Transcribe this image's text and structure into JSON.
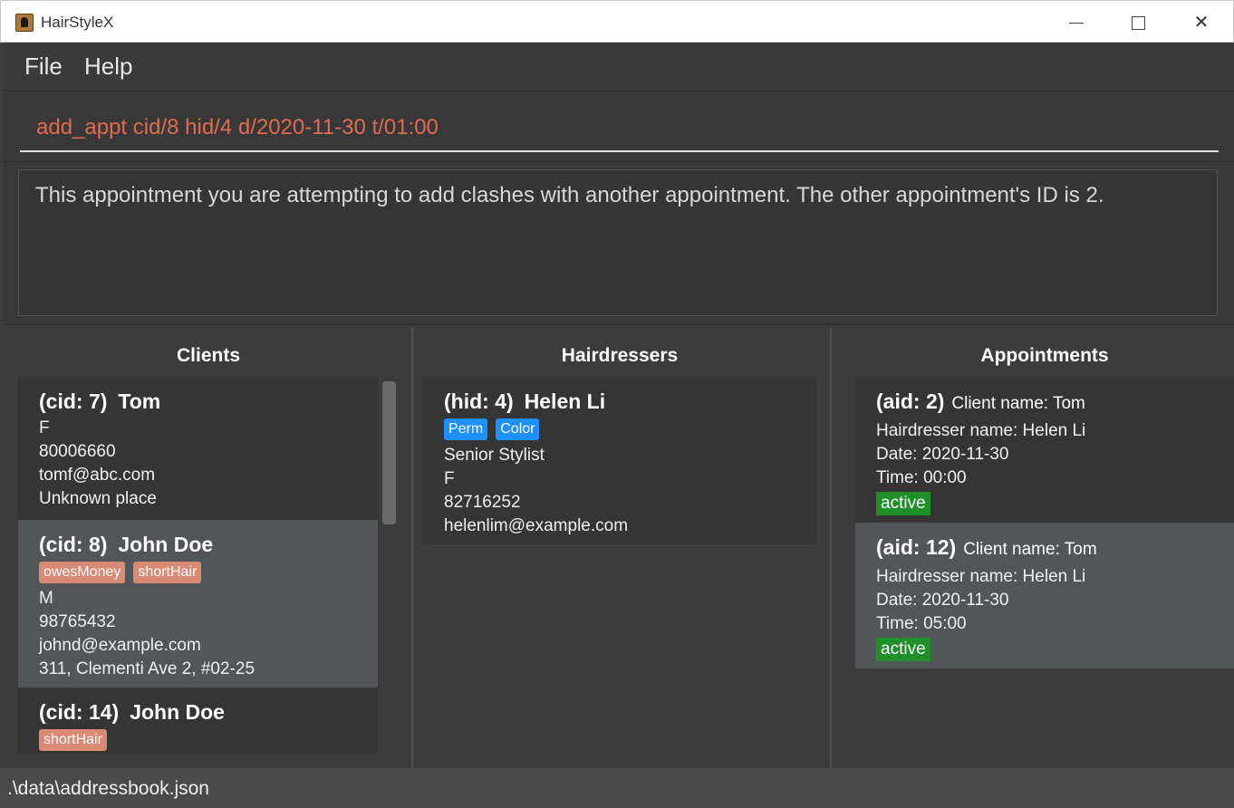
{
  "window": {
    "title": "HairStyleX",
    "icon": "portrait-icon"
  },
  "menu": {
    "file": "File",
    "help": "Help"
  },
  "command": {
    "value": "add_appt cid/8 hid/4 d/2020-11-30 t/01:00"
  },
  "result": {
    "message": "This appointment you are attempting to add clashes with another appointment. The other appointment's ID is 2."
  },
  "panels": {
    "clients_title": "Clients",
    "hairdressers_title": "Hairdressers",
    "appointments_title": "Appointments"
  },
  "clients": [
    {
      "id": "(cid: 7)",
      "name": "Tom",
      "tags": [],
      "gender": "F",
      "phone": "80006660",
      "email": "tomf@abc.com",
      "address": "Unknown place"
    },
    {
      "id": "(cid: 8)",
      "name": "John Doe",
      "tags": [
        "owesMoney",
        "shortHair"
      ],
      "gender": "M",
      "phone": "98765432",
      "email": "johnd@example.com",
      "address": "311, Clementi Ave 2, #02-25"
    },
    {
      "id": "(cid: 14)",
      "name": "John Doe",
      "tags": [
        "shortHair"
      ]
    }
  ],
  "hairdressers": [
    {
      "id": "(hid: 4)",
      "name": "Helen Li",
      "specializations": [
        "Perm",
        "Color"
      ],
      "title": "Senior Stylist",
      "gender": "F",
      "phone": "82716252",
      "email": "helenlim@example.com"
    }
  ],
  "appointments": [
    {
      "id": "(aid: 2)",
      "client": "Client name:  Tom",
      "hairdresser": "Hairdresser name: Helen Li",
      "date": "Date: 2020-11-30",
      "time": "Time: 00:00",
      "status": "active"
    },
    {
      "id": "(aid: 12)",
      "client": "Client name:  Tom",
      "hairdresser": "Hairdresser name: Helen Li",
      "date": "Date: 2020-11-30",
      "time": "Time: 05:00",
      "status": "active"
    }
  ],
  "statusbar": {
    "path": ".\\data\\addressbook.json"
  },
  "colors": {
    "background": "#3c3c3c",
    "command_text": "#e06b50",
    "client_tag": "#d88a74",
    "skill_tag": "#1e90ff",
    "status_active": "#1f8f2a",
    "card_selected": "#515659"
  }
}
